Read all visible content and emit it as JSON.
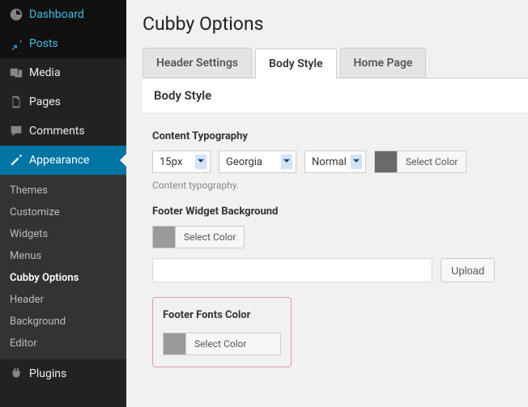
{
  "sidebar": {
    "items": [
      {
        "label": "Dashboard"
      },
      {
        "label": "Posts"
      },
      {
        "label": "Media"
      },
      {
        "label": "Pages"
      },
      {
        "label": "Comments"
      },
      {
        "label": "Appearance"
      },
      {
        "label": "Plugins"
      }
    ],
    "appearance_submenu": [
      {
        "label": "Themes"
      },
      {
        "label": "Customize"
      },
      {
        "label": "Widgets"
      },
      {
        "label": "Menus"
      },
      {
        "label": "Cubby Options"
      },
      {
        "label": "Header"
      },
      {
        "label": "Background"
      },
      {
        "label": "Editor"
      }
    ]
  },
  "page": {
    "title": "Cubby Options",
    "tabs": [
      {
        "label": "Header Settings"
      },
      {
        "label": "Body Style"
      },
      {
        "label": "Home Page"
      }
    ],
    "panel_title": "Body Style",
    "content_typography": {
      "label": "Content Typography",
      "size": "15px",
      "family": "Georgia",
      "weight": "Normal",
      "color_swatch": "#6a6a6a",
      "select_color": "Select Color",
      "help": "Content typography."
    },
    "footer_bg": {
      "label": "Footer Widget Background",
      "color_swatch": "#9a9a9a",
      "select_color": "Select Color",
      "upload": "Upload"
    },
    "footer_fonts": {
      "label": "Footer Fonts Color",
      "color_swatch": "#9a9a9a",
      "select_color": "Select Color"
    }
  }
}
